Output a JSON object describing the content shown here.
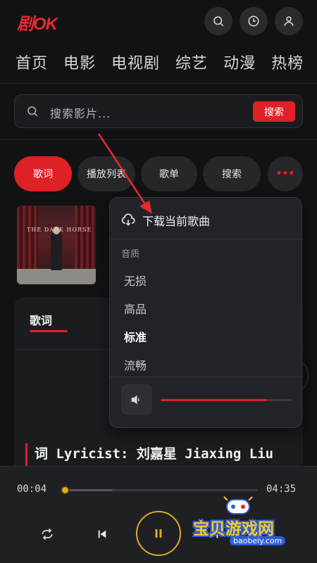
{
  "app": {
    "logo": "剧OK"
  },
  "header": {
    "icons": [
      "search-icon",
      "history-icon",
      "user-icon"
    ]
  },
  "nav": {
    "items": [
      "首页",
      "电影",
      "电视剧",
      "综艺",
      "动漫",
      "热榜"
    ]
  },
  "search": {
    "placeholder": "搜索影片...",
    "button_label": "搜索"
  },
  "tabs": [
    {
      "label": "歌词",
      "active": true
    },
    {
      "label": "播放列表",
      "active": false
    },
    {
      "label": "歌单",
      "active": false
    },
    {
      "label": "搜索",
      "active": false
    },
    {
      "label": "•••",
      "active": false
    }
  ],
  "album": {
    "cover_text": "THE DARK HORSE"
  },
  "lyrics_card": {
    "title": "歌词",
    "current_line": "词 Lyricist: 刘嘉星 Jiaxing Liu"
  },
  "menu": {
    "download_label": "下载当前歌曲",
    "quality_label": "音质",
    "quality_options": [
      {
        "label": "无损",
        "selected": false
      },
      {
        "label": "高品",
        "selected": false
      },
      {
        "label": "标准",
        "selected": true
      },
      {
        "label": "流畅",
        "selected": false
      }
    ],
    "volume_level": 0.81
  },
  "player": {
    "current_time": "00:04",
    "total_time": "04:35",
    "progress": 0.015,
    "controls": [
      "repeat-icon",
      "previous-icon",
      "pause-icon",
      "next-icon"
    ]
  },
  "watermark": {
    "title": "宝贝游戏网",
    "url": "baobeiy.com"
  },
  "colors": {
    "accent": "#de2027",
    "player_accent": "#e0a91e",
    "background": "#111214"
  }
}
